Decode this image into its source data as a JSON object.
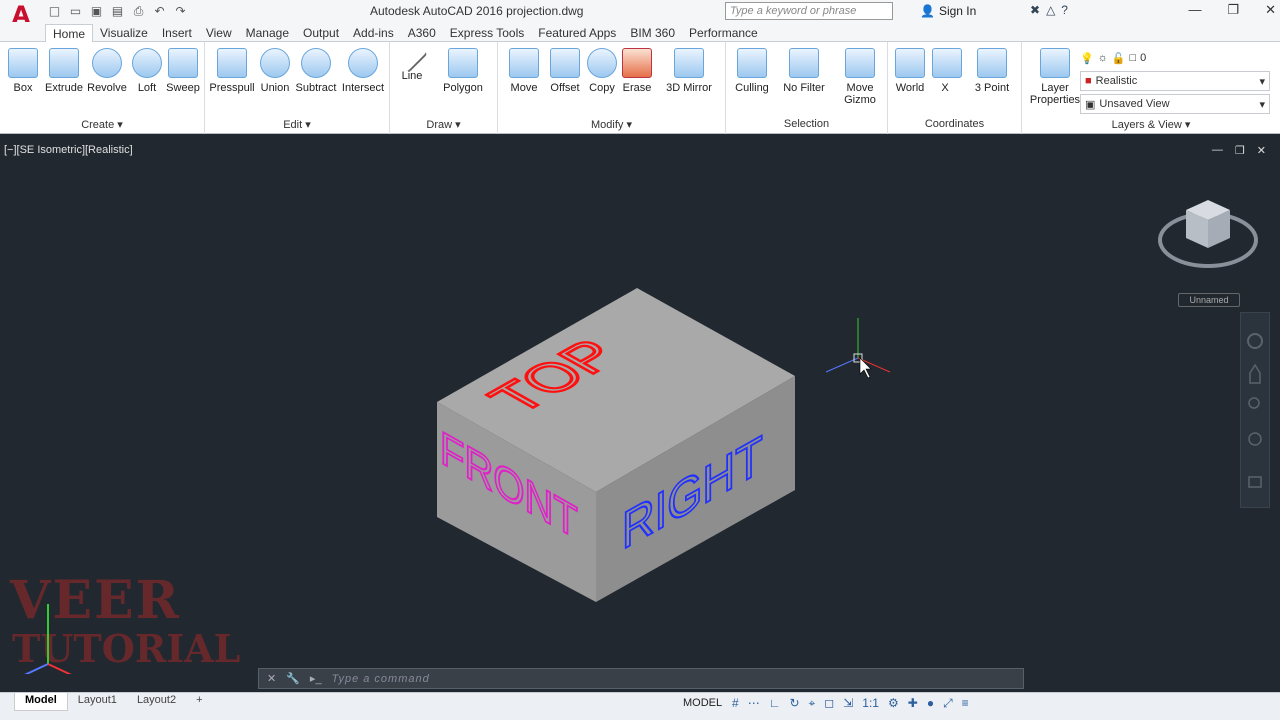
{
  "title": {
    "app_logo": "A",
    "document": "Autodesk AutoCAD 2016    projection.dwg",
    "search_placeholder": "Type a keyword or phrase",
    "sign_in": "Sign In"
  },
  "quick_access_icons": [
    "new-icon",
    "open-icon",
    "save-icon",
    "saveas-icon",
    "print-icon",
    "undo-icon",
    "redo-icon"
  ],
  "tabs": [
    {
      "label": "Home",
      "active": true
    },
    {
      "label": "Visualize"
    },
    {
      "label": "Insert"
    },
    {
      "label": "View"
    },
    {
      "label": "Manage"
    },
    {
      "label": "Output"
    },
    {
      "label": "Add-ins"
    },
    {
      "label": "A360"
    },
    {
      "label": "Express Tools"
    },
    {
      "label": "Featured Apps"
    },
    {
      "label": "BIM 360"
    },
    {
      "label": "Performance"
    }
  ],
  "ribbon": {
    "create": {
      "title": "Create",
      "tools": [
        "Box",
        "Extrude",
        "Revolve",
        "Loft",
        "Sweep"
      ]
    },
    "edit": {
      "title": "Edit",
      "tools": [
        "Presspull",
        "Union",
        "Subtract",
        "Intersect"
      ]
    },
    "draw": {
      "title": "Draw",
      "tools": [
        "Line",
        "Polygon"
      ]
    },
    "modify": {
      "title": "Modify",
      "tools": [
        "Move",
        "Offset",
        "Copy",
        "Erase",
        "3D Mirror"
      ]
    },
    "selection": {
      "title": "Selection",
      "tools": [
        "Culling",
        "No Filter",
        "Move Gizmo"
      ]
    },
    "coordinates": {
      "title": "Coordinates",
      "tools": [
        "World",
        "X",
        "3 Point"
      ]
    },
    "layers": {
      "title": "Layers & View",
      "layer_properties": "Layer Properties",
      "layer_value": "0",
      "visual_style": "Realistic",
      "view": "Unsaved View"
    }
  },
  "viewport": {
    "label": "[−][SE Isometric][Realistic]",
    "viewcube_label": "Unnamed",
    "cube_faces": {
      "top": "TOP",
      "front": "FRONT",
      "right": "RIGHT"
    },
    "colors": {
      "top": "#ff1010",
      "front": "#e020c8",
      "right": "#2030ff",
      "box": "#a8a8a8"
    }
  },
  "watermark": {
    "line1": "VEER",
    "line2": "TUTORIAL"
  },
  "command": {
    "placeholder": "Type  a  command"
  },
  "status": {
    "layout_tabs": [
      "Model",
      "Layout1",
      "Layout2"
    ],
    "add_tab": "+",
    "model": "MODEL",
    "scale": "1:1"
  }
}
